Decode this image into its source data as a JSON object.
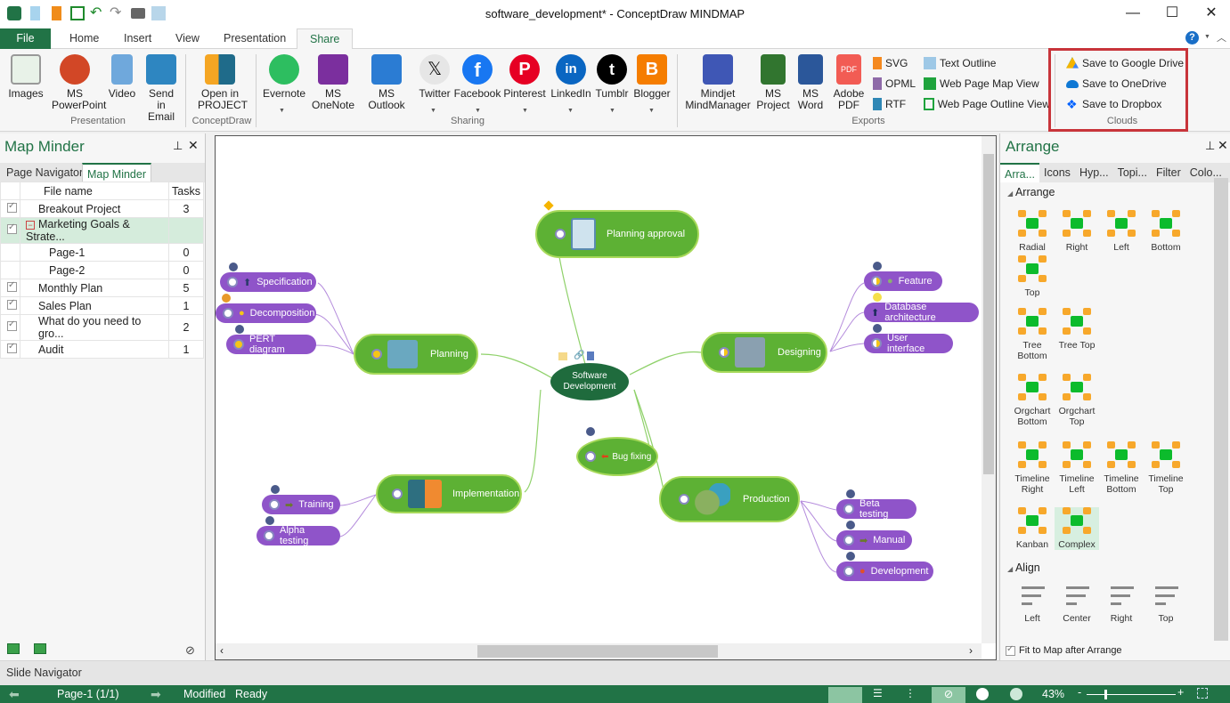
{
  "window": {
    "title": "software_development* - ConceptDraw MINDMAP",
    "controls": [
      "minimize",
      "maximize",
      "close"
    ]
  },
  "quick_access": [
    "app-logo-icon",
    "new-file-icon",
    "open-file-icon",
    "save-icon",
    "undo-icon",
    "redo-icon",
    "print-icon",
    "print-preview-icon"
  ],
  "tabs": [
    {
      "label": "File"
    },
    {
      "label": "Home"
    },
    {
      "label": "Insert"
    },
    {
      "label": "View"
    },
    {
      "label": "Presentation"
    },
    {
      "label": "Share",
      "active": true
    }
  ],
  "ribbon": {
    "presentation": {
      "group_label": "Presentation",
      "images": "Images",
      "powerpoint": "MS PowerPoint",
      "video": "Video",
      "email": "Send in Email"
    },
    "conceptdraw": {
      "group_label": "ConceptDraw",
      "project": "Open in PROJECT"
    },
    "sharing": {
      "group_label": "Sharing",
      "evernote": "Evernote",
      "onenote": "MS OneNote",
      "outlook": "MS Outlook",
      "twitter": "Twitter",
      "facebook": "Facebook",
      "pinterest": "Pinterest",
      "linkedin": "LinkedIn",
      "tumblr": "Tumblr",
      "blogger": "Blogger"
    },
    "exports": {
      "group_label": "Exports",
      "mindmanager": "Mindjet MindManager",
      "msproject": "MS Project",
      "msword": "MS Word",
      "pdf": "Adobe PDF",
      "svg": "SVG",
      "opml": "OPML",
      "rtf": "RTF",
      "text_outline": "Text Outline",
      "web_map": "Web Page Map View",
      "web_outline": "Web Page Outline View"
    },
    "clouds": {
      "group_label": "Clouds",
      "google": "Save to Google Drive",
      "onedrive": "Save to OneDrive",
      "dropbox": "Save to Dropbox"
    }
  },
  "left_panel": {
    "title": "Map Minder",
    "tabs": [
      "Page Navigator",
      "Map Minder"
    ],
    "active_tab": "Map Minder",
    "columns": [
      "File name",
      "Tasks"
    ],
    "rows": [
      {
        "name": "Breakout Project",
        "tasks": "3",
        "checked": true,
        "indent": 1
      },
      {
        "name": "Marketing Goals & Strate...",
        "tasks": "",
        "checked": true,
        "indent": 1,
        "expanded": true,
        "selected": true
      },
      {
        "name": "Page-1",
        "tasks": "0",
        "checked": false,
        "indent": 2
      },
      {
        "name": "Page-2",
        "tasks": "0",
        "checked": false,
        "indent": 2
      },
      {
        "name": "Monthly Plan",
        "tasks": "5",
        "checked": true,
        "indent": 1
      },
      {
        "name": "Sales Plan",
        "tasks": "1",
        "checked": true,
        "indent": 1
      },
      {
        "name": "What do you need to gro...",
        "tasks": "2",
        "checked": true,
        "indent": 1
      },
      {
        "name": "Audit",
        "tasks": "1",
        "checked": true,
        "indent": 1
      }
    ]
  },
  "mindmap": {
    "central": "Software Development",
    "main_topics": [
      {
        "label": "Planning approval"
      },
      {
        "label": "Planning",
        "subtopics": [
          "Specification",
          "Decomposition",
          "PERT diagram"
        ]
      },
      {
        "label": "Designing",
        "subtopics": [
          "Feature",
          "Database architecture",
          "User interface"
        ]
      },
      {
        "label": "Bug fixing"
      },
      {
        "label": "Implementation",
        "subtopics": [
          "Training",
          "Alpha testing"
        ]
      },
      {
        "label": "Production",
        "subtopics": [
          "Beta testing",
          "Manual",
          "Development"
        ]
      }
    ],
    "colors": {
      "main": "#5db134",
      "central": "#1f6b3d",
      "sub": "#8f54c9"
    }
  },
  "right_panel": {
    "title": "Arrange",
    "tabs": [
      "Arra...",
      "Icons",
      "Hyp...",
      "Topi...",
      "Filter",
      "Colo..."
    ],
    "arrange_section": "Arrange",
    "arrange_items": [
      "Radial",
      "Right",
      "Left",
      "Bottom",
      "Top",
      "Tree Bottom",
      "Tree Top",
      "Orgchart Bottom",
      "Orgchart Top",
      "Timeline Right",
      "Timeline Left",
      "Timeline Bottom",
      "Timeline Top",
      "Kanban",
      "Complex"
    ],
    "selected_arrange": "Complex",
    "align_section": "Align",
    "align_items": [
      "Left",
      "Center",
      "Right",
      "Top"
    ],
    "fit_checkbox": "Fit to Map after Arrange",
    "fit_checked": true
  },
  "slide_navigator": "Slide Navigator",
  "status": {
    "page": "Page-1 (1/1)",
    "modified": "Modified",
    "ready": "Ready",
    "zoom": "43%"
  }
}
